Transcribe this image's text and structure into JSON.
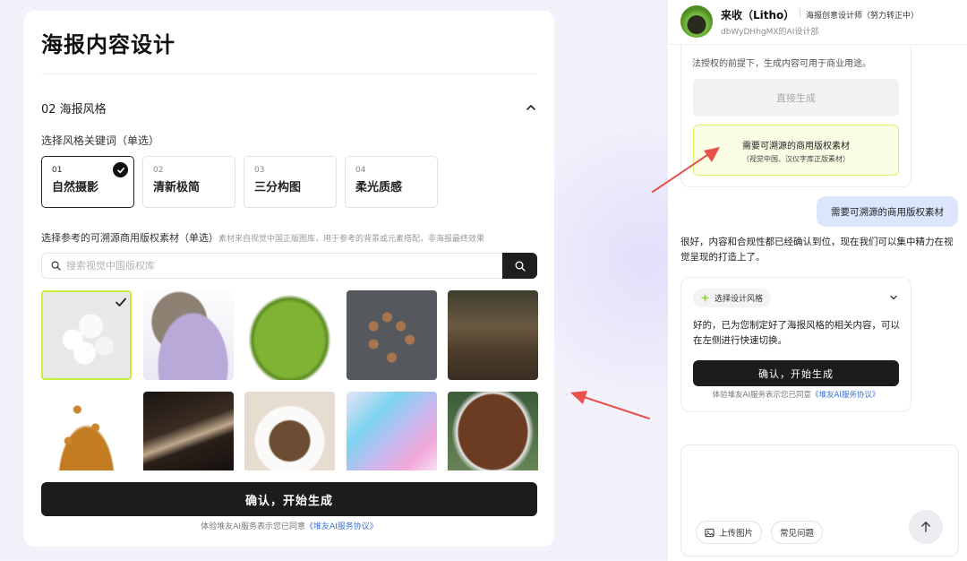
{
  "left_panel": {
    "title": "海报内容设计",
    "section_title": "02 海报风格",
    "keyword_label": "选择风格关键词（单选）",
    "keywords": [
      {
        "num": "01",
        "name": "自然摄影",
        "selected": true
      },
      {
        "num": "02",
        "name": "清新极简",
        "selected": false
      },
      {
        "num": "03",
        "name": "三分构图",
        "selected": false
      },
      {
        "num": "04",
        "name": "柔光质感",
        "selected": false
      }
    ],
    "reference_label": "选择参考的可溯源商用版权素材（单选）",
    "reference_hint": "素材来自视觉中国正版图库，用于参考的背景或元素搭配，非海报最终效果",
    "search_placeholder": "搜索视觉中国版权库",
    "selected_tile_index": 0,
    "confirm_label": "确认，开始生成",
    "agreement_prefix": "体验堆友AI服务表示您已同意",
    "agreement_link": "《堆友AI服务协议》"
  },
  "right_panel": {
    "agent_name": "来收（Litho）",
    "agent_role": "海报创意设计师（努力转正中）",
    "agent_org": "dbWyDHhgMX的AI设计部",
    "clipped_text": "法授权的前提下，生成内容可用于商业用途。",
    "direct_label": "直接生成",
    "need_title": "需要可溯源的商用版权素材",
    "need_subtitle": "（视觉中国、汉仪字库正版素材）",
    "user_message": "需要可溯源的商用版权素材",
    "ai_message": "很好，内容和合规性都已经确认到位，现在我们可以集中精力在视觉呈现的打造上了。",
    "style_chip": "选择设计风格",
    "card_text": "好的，已为您制定好了海报风格的相关内容，可以在左侧进行快速切换。",
    "card_button": "确认，开始生成",
    "card_agreement_prefix": "体验堆友AI服务表示您已同意",
    "card_agreement_link": "《堆友AI服务协议》",
    "upload_label": "上传图片",
    "faq_label": "常见问题"
  },
  "colors": {
    "accent_lime": "#c8ef3c",
    "dark_button": "#1c1c1c",
    "link_blue": "#3b73d9",
    "user_bubble": "#dbe6fc",
    "annotation_arrow": "#e8504a"
  }
}
